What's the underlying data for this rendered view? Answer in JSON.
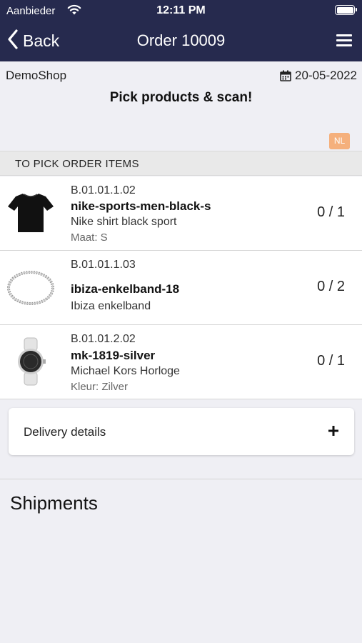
{
  "status_bar": {
    "carrier": "Aanbieder",
    "time": "12:11 PM"
  },
  "nav": {
    "back_label": "Back",
    "title": "Order 10009"
  },
  "header": {
    "shop": "DemoShop",
    "date": "20-05-2022",
    "subtitle": "Pick products & scan!",
    "language": "NL"
  },
  "section": {
    "title": "TO PICK ORDER ITEMS"
  },
  "items": [
    {
      "location": "B.01.01.1.02",
      "sku": "nike-sports-men-black-s",
      "name": "Nike shirt black sport",
      "attribute": "Maat: S",
      "quantity": "0 / 1",
      "image_icon": "tshirt-icon"
    },
    {
      "location": "B.01.01.1.03",
      "sku": "ibiza-enkelband-18",
      "name": "Ibiza enkelband",
      "attribute": "",
      "quantity": "0 / 2",
      "image_icon": "anklet-icon"
    },
    {
      "location": "B.01.01.2.02",
      "sku": "mk-1819-silver",
      "name": "Michael Kors Horloge",
      "attribute": "Kleur: Zilver",
      "quantity": "0 / 1",
      "image_icon": "watch-icon"
    }
  ],
  "delivery": {
    "label": "Delivery details"
  },
  "shipments": {
    "title": "Shipments"
  },
  "colors": {
    "navbar": "#262a4e",
    "language_badge": "#f5b07c",
    "background": "#efeff4"
  }
}
